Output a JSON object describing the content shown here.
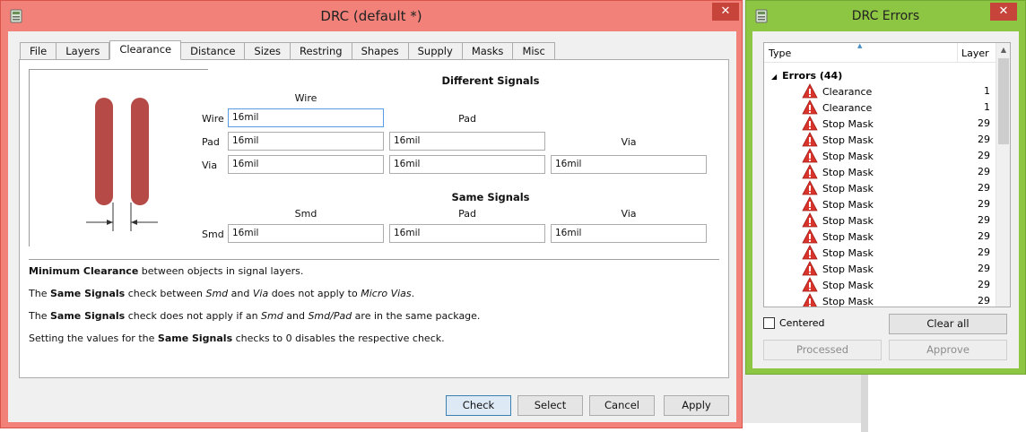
{
  "drc_window": {
    "title": "DRC (default *)",
    "close_glyph": "✕",
    "icon": "eagle-app-icon",
    "tabs": [
      {
        "label": "File"
      },
      {
        "label": "Layers"
      },
      {
        "label": "Clearance",
        "active": true
      },
      {
        "label": "Distance"
      },
      {
        "label": "Sizes"
      },
      {
        "label": "Restring"
      },
      {
        "label": "Shapes"
      },
      {
        "label": "Supply"
      },
      {
        "label": "Masks"
      },
      {
        "label": "Misc"
      }
    ],
    "different_signals": {
      "title": "Different Signals",
      "col_wire": "Wire",
      "col_pad": "Pad",
      "col_via": "Via",
      "row_wire": "Wire",
      "row_pad": "Pad",
      "row_via": "Via",
      "wire_wire": "16mil",
      "pad_wire": "16mil",
      "pad_pad": "16mil",
      "via_wire": "16mil",
      "via_pad": "16mil",
      "via_via": "16mil"
    },
    "same_signals": {
      "title": "Same Signals",
      "col_smd": "Smd",
      "col_pad": "Pad",
      "col_via": "Via",
      "row_smd": "Smd",
      "smd_smd": "16mil",
      "smd_pad": "16mil",
      "smd_via": "16mil"
    },
    "desc": {
      "l1_b": "Minimum Clearance",
      "l1_t": " between objects in signal layers.",
      "l2_a": "The ",
      "l2_b": "Same Signals",
      "l2_c": " check between ",
      "l2_i1": "Smd",
      "l2_d": " and ",
      "l2_i2": "Via",
      "l2_e": " does not apply to ",
      "l2_i3": "Micro Vias",
      "l2_f": ".",
      "l3_a": "The ",
      "l3_b": "Same Signals",
      "l3_c": " check does not apply if an ",
      "l3_i1": "Smd",
      "l3_d": " and ",
      "l3_i2": "Smd/Pad",
      "l3_e": " are in the same package.",
      "l4_a": "Setting the values for the ",
      "l4_b": "Same Signals",
      "l4_c": " checks to 0 disables the respective check."
    },
    "buttons": {
      "check": "Check",
      "select": "Select",
      "cancel": "Cancel",
      "apply": "Apply"
    },
    "colors": {
      "frame": "#f28179",
      "pad_fill": "#b64a47"
    }
  },
  "errors_window": {
    "title": "DRC Errors",
    "close_glyph": "✕",
    "icon": "eagle-app-icon",
    "col_type": "Type",
    "col_layer": "Layer",
    "group_label": "Errors (44)",
    "rows": [
      {
        "type": "Clearance",
        "layer": "1"
      },
      {
        "type": "Clearance",
        "layer": "1"
      },
      {
        "type": "Stop Mask",
        "layer": "29"
      },
      {
        "type": "Stop Mask",
        "layer": "29"
      },
      {
        "type": "Stop Mask",
        "layer": "29"
      },
      {
        "type": "Stop Mask",
        "layer": "29"
      },
      {
        "type": "Stop Mask",
        "layer": "29"
      },
      {
        "type": "Stop Mask",
        "layer": "29"
      },
      {
        "type": "Stop Mask",
        "layer": "29"
      },
      {
        "type": "Stop Mask",
        "layer": "29"
      },
      {
        "type": "Stop Mask",
        "layer": "29"
      },
      {
        "type": "Stop Mask",
        "layer": "29"
      },
      {
        "type": "Stop Mask",
        "layer": "29"
      },
      {
        "type": "Stop Mask",
        "layer": "29"
      }
    ],
    "centered_label": "Centered",
    "centered_checked": false,
    "buttons": {
      "clear_all": "Clear all",
      "processed": "Processed",
      "approve": "Approve"
    },
    "colors": {
      "frame": "#8dc642",
      "warning": "#d9342b"
    }
  }
}
